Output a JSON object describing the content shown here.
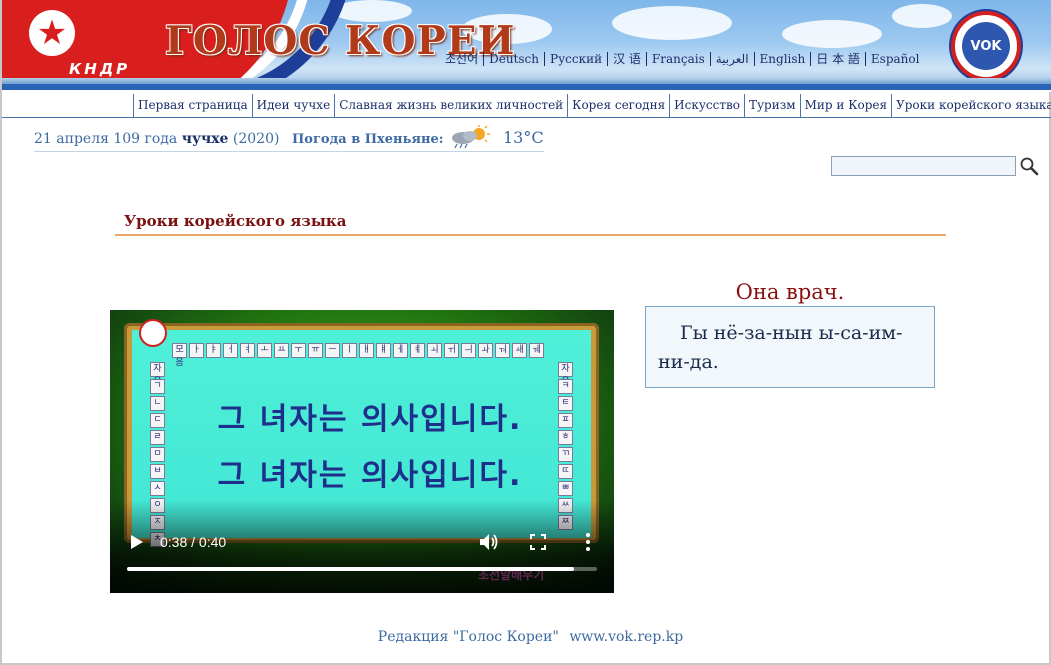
{
  "header": {
    "site_title": "ГОЛОС КОРЕИ",
    "country_badge": "КНДР",
    "logo_text": "VOK",
    "languages": [
      "조선어",
      "Deutsch",
      "Русский",
      "汉 语",
      "Français",
      "العربية",
      "English",
      "日 本 語",
      "Español"
    ]
  },
  "nav": {
    "items": [
      "Первая страница",
      "Идеи чучхе",
      "Славная жизнь великих личностей",
      "Корея сегодня",
      "Искусство",
      "Туризм",
      "Мир и Корея",
      "Уроки корейского языка"
    ]
  },
  "date_bar": {
    "date_prefix": "21 апреля 109 года",
    "juche": "чучхе",
    "year": "(2020)",
    "weather_label": "Погода в Пхеньяне:",
    "weather_icon": "partly-cloudy-rain-icon",
    "temperature": "13°C"
  },
  "search": {
    "value": "",
    "placeholder": "",
    "icon": "search-icon"
  },
  "section": {
    "title": "Уроки корейского языка"
  },
  "video": {
    "vowels": [
      "모음",
      "ㅏ",
      "ㅑ",
      "ㅓ",
      "ㅕ",
      "ㅗ",
      "ㅛ",
      "ㅜ",
      "ㅠ",
      "ㅡ",
      "ㅣ",
      "ㅐ",
      "ㅒ",
      "ㅔ",
      "ㅖ",
      "ㅚ",
      "ㅟ",
      "ㅢ",
      "ㅘ",
      "ㅝ",
      "ㅙ",
      "ㅞ"
    ],
    "consonants_left": [
      "자음",
      "ㄱ",
      "ㄴ",
      "ㄷ",
      "ㄹ",
      "ㅁ",
      "ㅂ",
      "ㅅ",
      "ㅇ",
      "ㅈ",
      "ㅊ"
    ],
    "consonants_right": [
      "자음",
      "ㅋ",
      "ㅌ",
      "ㅍ",
      "ㅎ",
      "ㄲ",
      "ㄸ",
      "ㅃ",
      "ㅆ",
      "ㅉ"
    ],
    "korean_line_1": "그 녀자는 의사입니다.",
    "korean_line_2": "그 녀자는 의사입니다.",
    "time": "0:38 / 0:40",
    "progress": 0.95,
    "caption": "조선말배우기"
  },
  "lesson": {
    "phrase_ru": "Она врач.",
    "transliteration": "Гы нё-за-нын ы-са-им-ни-да."
  },
  "footer": {
    "editorial": "Редакция \"Голос Кореи\"",
    "website": "www.vok.rep.kp"
  },
  "colors": {
    "brand_red": "#d91e1e",
    "brand_blue": "#1d3f99",
    "section_title": "#7a1010",
    "link_blue": "#3d6aa0",
    "accent_orange": "#e8a86a"
  }
}
